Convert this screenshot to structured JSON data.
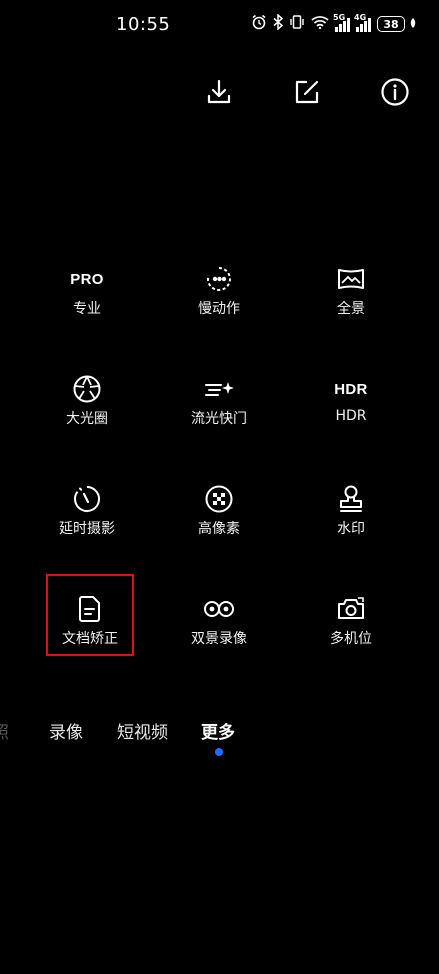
{
  "status_bar": {
    "time": "10:55",
    "net1": "5G",
    "net2": "4G",
    "battery": "38"
  },
  "toolbar": {
    "download_icon": "download-icon",
    "edit_icon": "edit-icon",
    "info_icon": "info-icon"
  },
  "modes": [
    {
      "id": "pro",
      "icon_text": "PRO",
      "label": "专业"
    },
    {
      "id": "slowmo",
      "icon": "slowmo-icon",
      "label": "慢动作"
    },
    {
      "id": "pano",
      "icon": "panorama-icon",
      "label": "全景"
    },
    {
      "id": "aperture",
      "icon": "aperture-icon",
      "label": "大光圈"
    },
    {
      "id": "lightpaint",
      "icon": "light-trail-icon",
      "label": "流光快门"
    },
    {
      "id": "hdr",
      "icon_text": "HDR",
      "label": "HDR"
    },
    {
      "id": "timelapse",
      "icon": "timelapse-icon",
      "label": "延时摄影"
    },
    {
      "id": "hires",
      "icon": "high-resolution-icon",
      "label": "高像素"
    },
    {
      "id": "watermark",
      "icon": "stamp-icon",
      "label": "水印"
    },
    {
      "id": "doc",
      "icon": "document-icon",
      "label": "文档矫正"
    },
    {
      "id": "dualview",
      "icon": "dual-view-icon",
      "label": "双景录像"
    },
    {
      "id": "multicam",
      "icon": "camera-icon",
      "label": "多机位"
    }
  ],
  "tabs": {
    "partial": "照",
    "video": "录像",
    "short_video": "短视频",
    "more": "更多"
  },
  "colors": {
    "accent_dot": "#1a6bff",
    "highlight_box": "#e01010",
    "background": "#000000"
  }
}
